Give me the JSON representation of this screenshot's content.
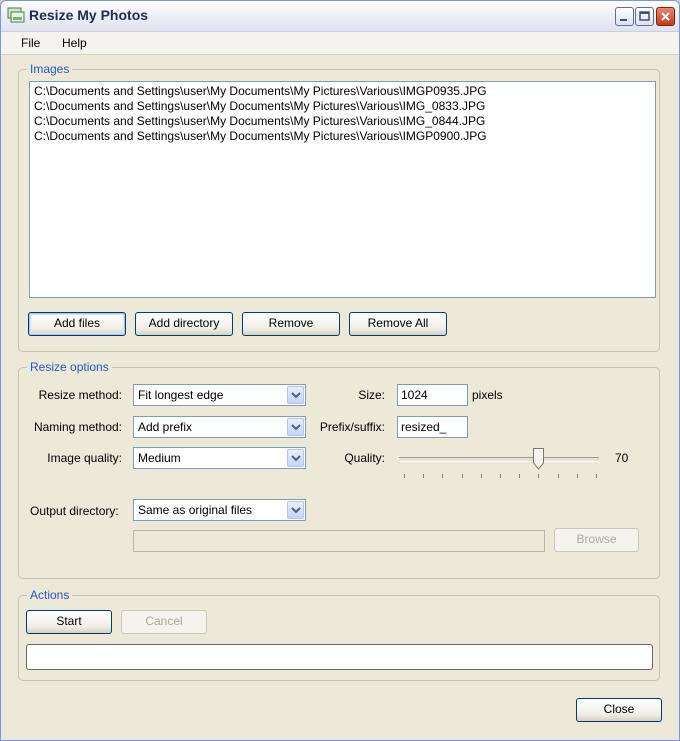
{
  "window": {
    "title": "Resize My Photos",
    "app_icon": "photos-app-icon",
    "controls": [
      "minimize-icon",
      "maximize-icon",
      "close-icon"
    ]
  },
  "menu": {
    "file": "File",
    "help": "Help"
  },
  "images": {
    "legend": "Images",
    "files": [
      "C:\\Documents and Settings\\user\\My Documents\\My Pictures\\Various\\IMGP0935.JPG",
      "C:\\Documents and Settings\\user\\My Documents\\My Pictures\\Various\\IMG_0833.JPG",
      "C:\\Documents and Settings\\user\\My Documents\\My Pictures\\Various\\IMG_0844.JPG",
      "C:\\Documents and Settings\\user\\My Documents\\My Pictures\\Various\\IMGP0900.JPG"
    ],
    "buttons": {
      "add_files": "Add files",
      "add_directory": "Add directory",
      "remove": "Remove",
      "remove_all": "Remove All"
    }
  },
  "resize": {
    "legend": "Resize options",
    "resize_method_label": "Resize method:",
    "resize_method_value": "Fit longest edge",
    "naming_method_label": "Naming method:",
    "naming_method_value": "Add prefix",
    "image_quality_label": "Image quality:",
    "image_quality_value": "Medium",
    "size_label": "Size:",
    "size_value": "1024",
    "size_unit": "pixels",
    "prefix_label": "Prefix/suffix:",
    "prefix_value": "resized_",
    "quality_label": "Quality:",
    "quality_value": "70",
    "quality_level": 0.7,
    "output_dir_label": "Output directory:",
    "output_dir_value": "Same as original files",
    "output_path_value": "",
    "browse": "Browse"
  },
  "actions": {
    "legend": "Actions",
    "start": "Start",
    "cancel": "Cancel",
    "progress": 0
  },
  "footer": {
    "close": "Close"
  },
  "colors": {
    "legend": "#2457c6",
    "window_bg": "#ece9d8",
    "border": "#7f9db9"
  }
}
